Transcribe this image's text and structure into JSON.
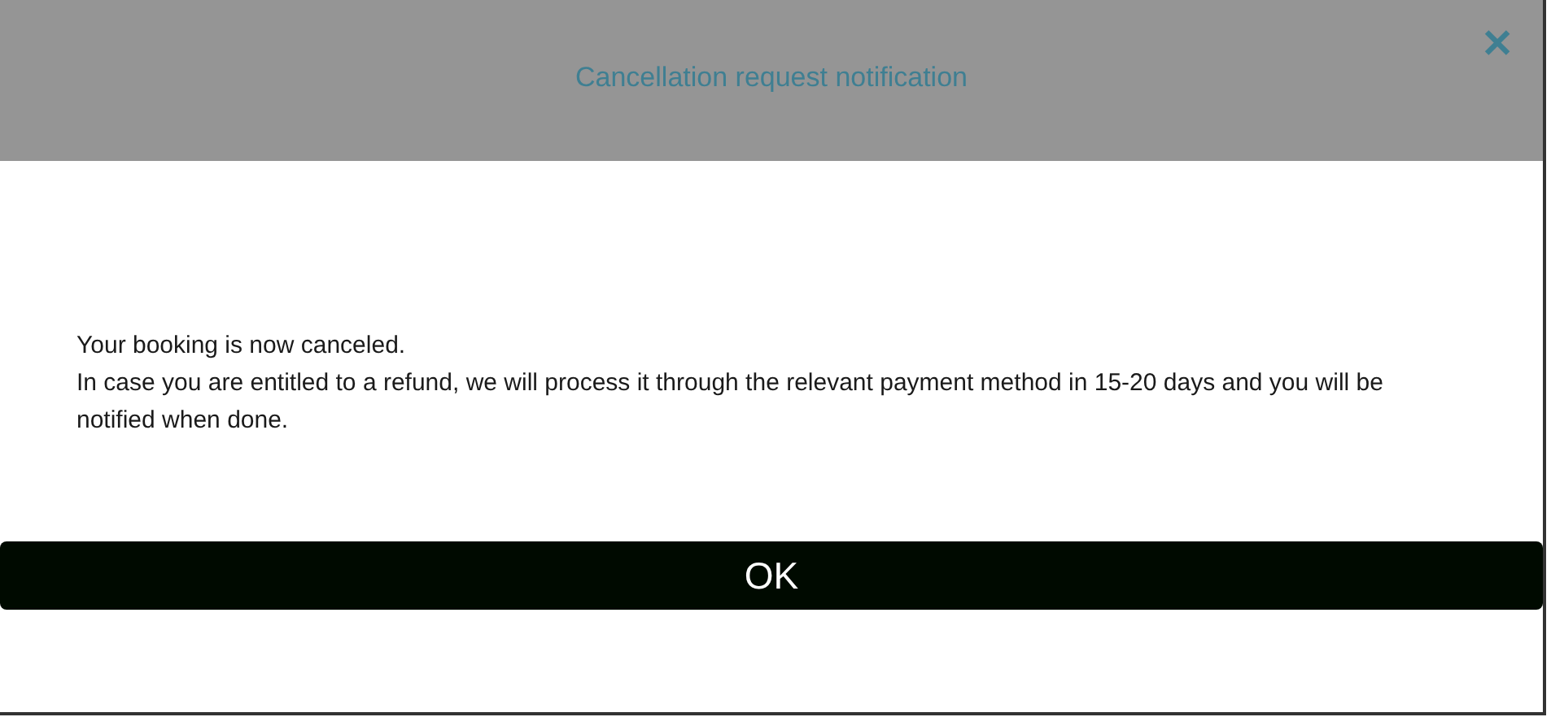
{
  "dialog": {
    "title": "Cancellation request notification",
    "close": "✕",
    "message": [
      "Your booking is now canceled.",
      "In case you are entitled to a refund, we will process it through the relevant payment method in 15-20 days and you will be notified when done."
    ],
    "buttons": [
      "OK"
    ]
  }
}
